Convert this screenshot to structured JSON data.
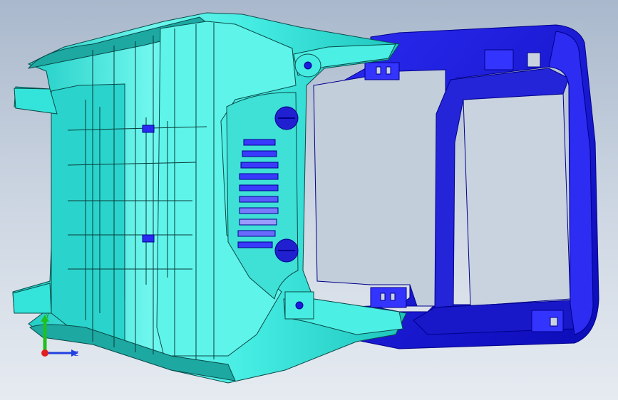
{
  "viewport": {
    "background_top": "#a9b8cc",
    "background_bottom": "#e6ebf1"
  },
  "model": {
    "cyan_part_color": "#3ff0e0",
    "blue_part_color": "#1b1be6"
  },
  "triad": {
    "y_label": "Y",
    "z_label": "Z",
    "x_color": "#e02020",
    "y_color": "#20c020",
    "z_color": "#2040e0"
  }
}
